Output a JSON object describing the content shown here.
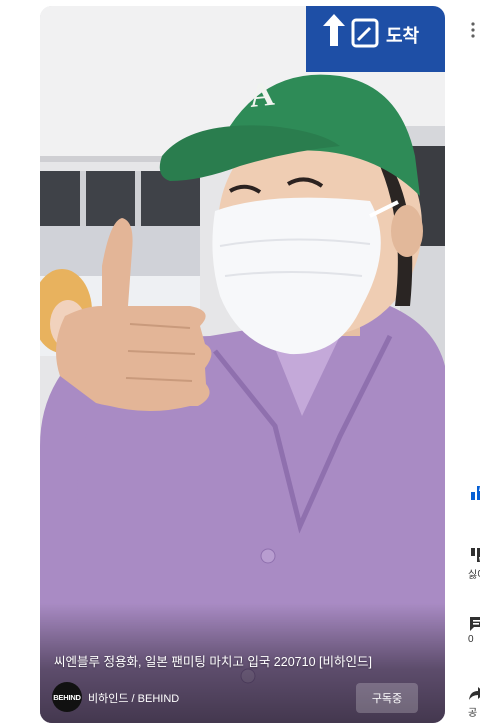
{
  "video": {
    "title": "씨엔블루 정용화, 일본 팬미팅 마치고 입국 220710 [비하인드]",
    "sign_text": "도착"
  },
  "channel": {
    "avatar_text": "BEHIND",
    "name": "비하인드 / BEHIND"
  },
  "subscribe": {
    "label": "구독중"
  },
  "actions": {
    "like_icon": "thumbs-up-icon",
    "dislike_icon": "thumbs-down-icon",
    "dislike_label": "싫어",
    "comment_icon": "comment-icon",
    "comment_label": "0",
    "share_icon": "share-icon",
    "share_label": "공"
  },
  "colors": {
    "sign_blue": "#1e4fa6",
    "cap_green": "#2e8b57",
    "shirt_lavender": "#a98bc4",
    "like_blue": "#065fd4"
  }
}
